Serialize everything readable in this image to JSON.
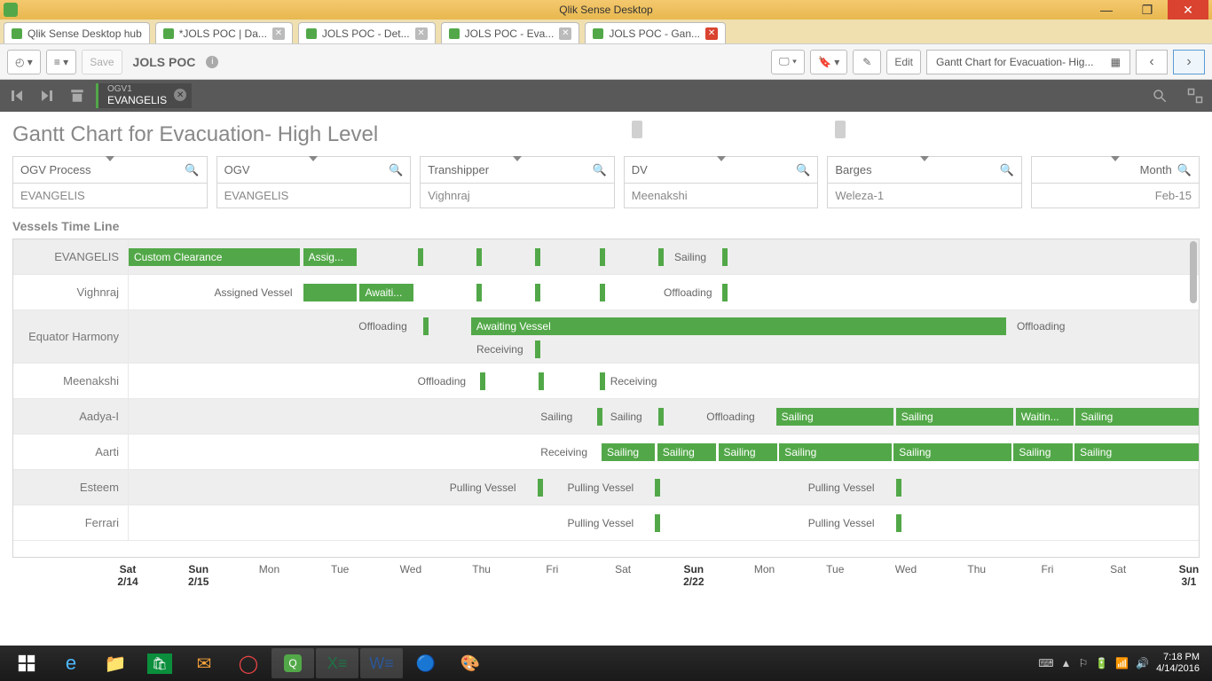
{
  "window": {
    "title": "Qlik Sense Desktop"
  },
  "tabs": [
    {
      "label": "Qlik Sense Desktop hub",
      "active": false
    },
    {
      "label": "*JOLS POC | Da...",
      "active": false
    },
    {
      "label": "JOLS POC - Det...",
      "active": false
    },
    {
      "label": "JOLS POC - Eva...",
      "active": false
    },
    {
      "label": "JOLS POC - Gan...",
      "active": true
    }
  ],
  "toolbar": {
    "save": "Save",
    "app_name": "JOLS POC",
    "edit": "Edit",
    "sheet": "Gantt Chart for Evacuation- Hig..."
  },
  "selection": {
    "field": "OGV1",
    "value": "EVANGELIS"
  },
  "page_title": "Gantt Chart for Evacuation- High Level",
  "filters": [
    {
      "title": "OGV Process",
      "value": "EVANGELIS"
    },
    {
      "title": "OGV",
      "value": "EVANGELIS"
    },
    {
      "title": "Transhipper",
      "value": "Vighnraj"
    },
    {
      "title": "DV",
      "value": "Meenakshi"
    },
    {
      "title": "Barges",
      "value": "Weleza-1"
    },
    {
      "title": "Month",
      "value": "Feb-15",
      "narrow": true
    }
  ],
  "gantt": {
    "title": "Vessels Time Line",
    "rows": [
      {
        "label": "EVANGELIS",
        "alt": true
      },
      {
        "label": "Vighnraj",
        "alt": false
      },
      {
        "label": "Equator Harmony",
        "alt": true,
        "tall": true
      },
      {
        "label": "Meenakshi",
        "alt": false
      },
      {
        "label": "Aadya-I",
        "alt": true
      },
      {
        "label": "Aarti",
        "alt": false
      },
      {
        "label": "Esteem",
        "alt": true
      },
      {
        "label": "Ferrari",
        "alt": false
      }
    ],
    "axis": [
      {
        "l": "Sat",
        "d": "2/14",
        "x": 0,
        "bold": true
      },
      {
        "l": "Sun",
        "d": "2/15",
        "x": 6.6,
        "bold": true
      },
      {
        "l": "Mon",
        "d": "",
        "x": 13.2
      },
      {
        "l": "Tue",
        "d": "",
        "x": 19.8
      },
      {
        "l": "Wed",
        "d": "",
        "x": 26.4
      },
      {
        "l": "Thu",
        "d": "",
        "x": 33.0
      },
      {
        "l": "Fri",
        "d": "",
        "x": 39.6
      },
      {
        "l": "Sat",
        "d": "",
        "x": 46.2
      },
      {
        "l": "Sun",
        "d": "2/22",
        "x": 52.8,
        "bold": true
      },
      {
        "l": "Mon",
        "d": "",
        "x": 59.4
      },
      {
        "l": "Tue",
        "d": "",
        "x": 66.0
      },
      {
        "l": "Wed",
        "d": "",
        "x": 72.6
      },
      {
        "l": "Thu",
        "d": "",
        "x": 79.2
      },
      {
        "l": "Fri",
        "d": "",
        "x": 85.8
      },
      {
        "l": "Sat",
        "d": "",
        "x": 92.4
      },
      {
        "l": "Sun",
        "d": "3/1",
        "x": 99.0,
        "bold": true
      },
      {
        "l": "Mon",
        "d": "",
        "x": 105.6
      },
      {
        "l": "Tue",
        "d": "",
        "x": 112.2
      },
      {
        "l": "Wed",
        "d": "",
        "x": 118.8
      }
    ]
  },
  "labels": {
    "custom_clearance": "Custom Clearance",
    "assig": "Assig...",
    "sailing": "Sailing",
    "assigned_vessel": "Assigned Vessel",
    "awaiti": "Awaiti...",
    "offloading": "Offloading",
    "awaiting_vessel": "Awaiting Vessel",
    "receiving": "Receiving",
    "pulling_vessel": "Pulling Vessel",
    "waitin": "Waitin..."
  },
  "tray": {
    "time": "7:18 PM",
    "date": "4/14/2016"
  },
  "chart_data": {
    "type": "gantt",
    "title": "Vessels Time Line",
    "x_range": [
      "2015-02-14",
      "2015-03-04"
    ],
    "rows": [
      {
        "vessel": "EVANGELIS",
        "tasks": [
          {
            "label": "Custom Clearance",
            "start": "2/14",
            "end": "2/17",
            "filled": true
          },
          {
            "label": "Assig...",
            "start": "2/17",
            "end": "2/18",
            "filled": true
          },
          {
            "label": "",
            "start": "2/19.5",
            "type": "tick"
          },
          {
            "label": "",
            "start": "2/20.5",
            "type": "tick"
          },
          {
            "label": "",
            "start": "2/21.5",
            "type": "tick"
          },
          {
            "label": "",
            "start": "2/22.5",
            "type": "tick"
          },
          {
            "label": "Sailing",
            "start": "2/23",
            "type": "text_tick"
          }
        ]
      },
      {
        "vessel": "Vighnraj",
        "tasks": [
          {
            "label": "Assigned Vessel",
            "start": "2/15",
            "end": "2/17",
            "filled": false
          },
          {
            "label": "",
            "start": "2/17",
            "end": "2/18",
            "filled": true
          },
          {
            "label": "Awaiti...",
            "start": "2/18",
            "end": "2/19",
            "filled": true
          },
          {
            "label": "",
            "start": "2/20",
            "type": "tick"
          },
          {
            "label": "",
            "start": "2/21",
            "type": "tick"
          },
          {
            "label": "",
            "start": "2/22.5",
            "type": "tick"
          },
          {
            "label": "Offloading",
            "start": "2/23",
            "type": "text_tick"
          }
        ]
      },
      {
        "vessel": "Equator Harmony",
        "tasks": [
          {
            "label": "Offloading",
            "start": "2/18.5",
            "type": "text_tick"
          },
          {
            "label": "Awaiting Vessel",
            "start": "2/20",
            "end": "3/1",
            "filled": true
          },
          {
            "label": "Offloading",
            "start": "3/1",
            "type": "text_tick"
          },
          {
            "label": "Receiving",
            "start": "2/20",
            "type": "text_tick",
            "row2": true
          }
        ]
      },
      {
        "vessel": "Meenakshi",
        "tasks": [
          {
            "label": "Offloading",
            "start": "2/19.5",
            "type": "text_tick"
          },
          {
            "label": "",
            "start": "2/21",
            "type": "tick"
          },
          {
            "label": "",
            "start": "2/22.3",
            "type": "tick"
          },
          {
            "label": "Receiving",
            "start": "2/22.5",
            "type": "text_tick"
          }
        ]
      },
      {
        "vessel": "Aadya-I",
        "tasks": [
          {
            "label": "Sailing",
            "start": "2/21",
            "type": "text_tick"
          },
          {
            "label": "Sailing",
            "start": "2/22",
            "type": "text_tick"
          },
          {
            "label": "Offloading",
            "start": "2/23.5",
            "type": "text_tick"
          },
          {
            "label": "Sailing",
            "start": "2/24.5",
            "end": "2/26.5",
            "filled": true
          },
          {
            "label": "Sailing",
            "start": "2/26.5",
            "end": "2/28.5",
            "filled": true
          },
          {
            "label": "Waitin...",
            "start": "3/1",
            "end": "3/2",
            "filled": true
          },
          {
            "label": "Sailing",
            "start": "3/2",
            "end": "3/4",
            "filled": true
          }
        ]
      },
      {
        "vessel": "Aarti",
        "tasks": [
          {
            "label": "Receiving",
            "start": "2/21",
            "type": "text_tick"
          },
          {
            "label": "Sailing",
            "start": "2/22.3",
            "end": "2/23.2",
            "filled": true
          },
          {
            "label": "Sailing",
            "start": "2/23.2",
            "end": "2/24",
            "filled": true
          },
          {
            "label": "Sailing",
            "start": "2/24",
            "end": "2/25",
            "filled": true
          },
          {
            "label": "Sailing",
            "start": "2/25",
            "end": "2/27",
            "filled": true
          },
          {
            "label": "Sailing",
            "start": "2/27",
            "end": "3/1",
            "filled": true
          },
          {
            "label": "Sailing",
            "start": "3/1",
            "end": "3/2",
            "filled": true
          },
          {
            "label": "Sailing",
            "start": "3/2",
            "end": "3/4",
            "filled": true
          }
        ]
      },
      {
        "vessel": "Esteem",
        "tasks": [
          {
            "label": "Pulling Vessel",
            "start": "2/20",
            "type": "text_tick"
          },
          {
            "label": "Pulling Vessel",
            "start": "2/22",
            "type": "text_tick"
          },
          {
            "label": "Pulling Vessel",
            "start": "2/26.5",
            "type": "text_tick"
          }
        ]
      },
      {
        "vessel": "Ferrari",
        "tasks": [
          {
            "label": "Pulling Vessel",
            "start": "2/22",
            "type": "text_tick"
          },
          {
            "label": "Pulling Vessel",
            "start": "2/26.5",
            "type": "text_tick"
          }
        ]
      }
    ]
  }
}
